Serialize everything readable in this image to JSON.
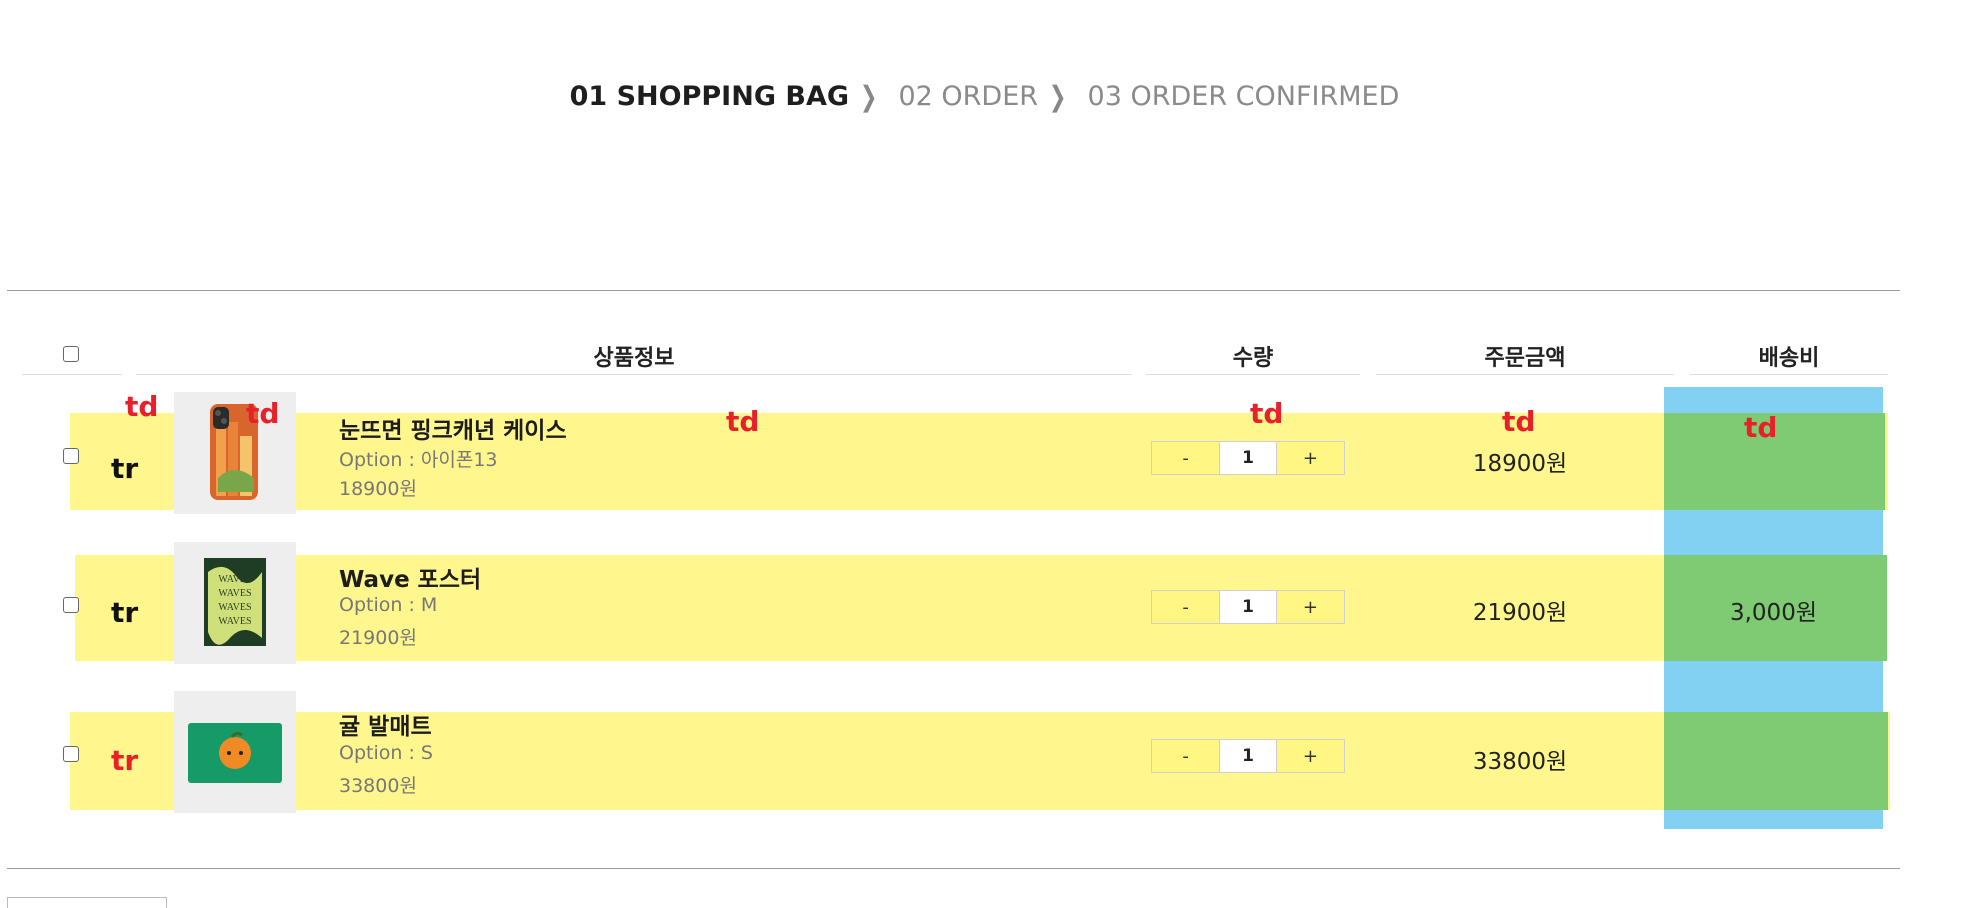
{
  "steps": {
    "step1": "01 SHOPPING BAG",
    "step2": "02 ORDER",
    "step3": "03 ORDER CONFIRMED",
    "separator": "❯"
  },
  "table": {
    "headers": {
      "product": "상품정보",
      "quantity": "수량",
      "amount": "주문금액",
      "shipping": "배송비"
    },
    "rows": [
      {
        "name": "눈뜨면 핑크캐년 케이스",
        "option": "Option : 아이폰13",
        "price": "18900원",
        "qty": "1",
        "amount": "18900원",
        "shipping": "",
        "thumb_icon": "phone-case-image"
      },
      {
        "name": "Wave 포스터",
        "option": "Option : M",
        "price": "21900원",
        "qty": "1",
        "amount": "21900원",
        "shipping": "3,000원",
        "thumb_icon": "wave-poster-image"
      },
      {
        "name": "귤 발매트",
        "option": "Option : S",
        "price": "33800원",
        "qty": "1",
        "amount": "33800원",
        "shipping": "",
        "thumb_icon": "tangerine-bathmat-image"
      }
    ],
    "minus": "-",
    "plus": "+"
  },
  "annotations": {
    "td": "td",
    "tr": "tr"
  },
  "colors": {
    "row_highlight": "#fff683",
    "column_highlight": "#82d0f2",
    "cell_highlight": "#7ecb73",
    "annotation_red": "#e8202a"
  }
}
